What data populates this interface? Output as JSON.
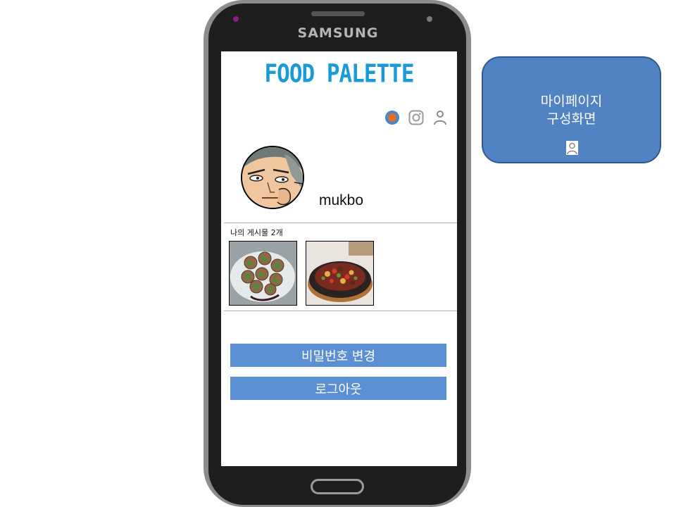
{
  "phone": {
    "brand": "SAMSUNG"
  },
  "app": {
    "logo": "FOOD PALETTE",
    "header_icons": [
      "profile-dot-icon",
      "instagram-icon",
      "person-icon"
    ]
  },
  "profile": {
    "username": "mukbo",
    "avatar_icon": "cartoon-face-avatar"
  },
  "posts": {
    "label": "나의 게시물 2개",
    "items": [
      {
        "icon": "rolled-food-photo"
      },
      {
        "icon": "stew-food-photo"
      }
    ]
  },
  "actions": {
    "change_password": "비밀번호 변경",
    "logout": "로그아웃"
  },
  "callout": {
    "line1": "마이페이지",
    "line2": "구성화면",
    "icon": "person-icon"
  },
  "colors": {
    "logo": "#1a9ad6",
    "button": "#5b8fd3",
    "callout_fill": "#5183c4",
    "callout_border": "#2f5a90"
  }
}
